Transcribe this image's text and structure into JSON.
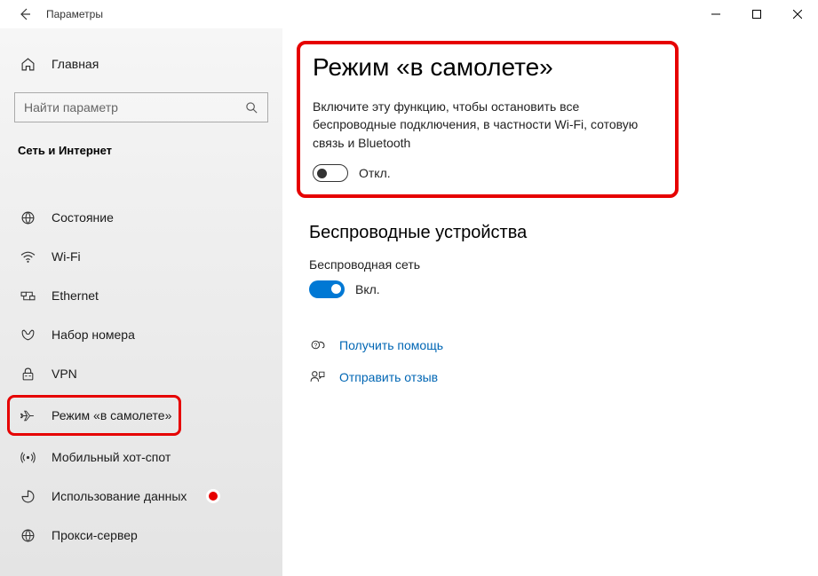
{
  "titlebar": {
    "title": "Параметры"
  },
  "sidebar": {
    "home": "Главная",
    "search_placeholder": "Найти параметр",
    "category": "Сеть и Интернет",
    "items": [
      {
        "label": "Состояние"
      },
      {
        "label": "Wi-Fi"
      },
      {
        "label": "Ethernet"
      },
      {
        "label": "Набор номера"
      },
      {
        "label": "VPN"
      },
      {
        "label": "Режим «в самолете»"
      },
      {
        "label": "Мобильный хот-спот"
      },
      {
        "label": "Использование данных"
      },
      {
        "label": "Прокси-сервер"
      }
    ]
  },
  "main": {
    "title": "Режим «в самолете»",
    "description": "Включите эту функцию, чтобы остановить все беспроводные подключения, в частности Wi-Fi, сотовую связь и Bluetooth",
    "airplane_toggle": {
      "state": "Откл."
    },
    "wireless_title": "Беспроводные устройства",
    "wireless_label": "Беспроводная сеть",
    "wireless_toggle": {
      "state": "Вкл."
    },
    "links": {
      "help": "Получить помощь",
      "feedback": "Отправить отзыв"
    }
  }
}
